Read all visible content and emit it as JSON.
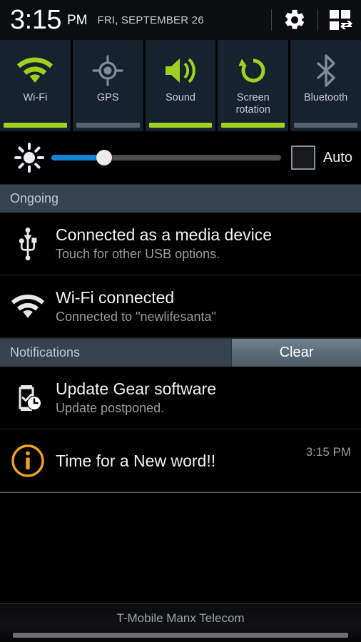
{
  "statusbar": {
    "time": "3:15",
    "ampm": "PM",
    "date": "FRI, SEPTEMBER 26",
    "settings_icon": "gear-icon",
    "panel_toggle_icon": "quick-settings-grid-icon"
  },
  "quick_toggles": [
    {
      "label": "Wi-Fi",
      "icon": "wifi-icon",
      "state": "on"
    },
    {
      "label": "GPS",
      "icon": "gps-crosshair-icon",
      "state": "off"
    },
    {
      "label": "Sound",
      "icon": "speaker-volume-icon",
      "state": "on"
    },
    {
      "label": "Screen\nrotation",
      "icon": "screen-rotation-icon",
      "state": "on"
    },
    {
      "label": "Bluetooth",
      "icon": "bluetooth-icon",
      "state": "off"
    }
  ],
  "brightness": {
    "icon": "brightness-sun-icon",
    "value_percent": 23,
    "auto_label": "Auto",
    "auto_checked": false
  },
  "sections": {
    "ongoing": {
      "title": "Ongoing"
    },
    "notifications": {
      "title": "Notifications",
      "clear_label": "Clear"
    }
  },
  "ongoing_items": [
    {
      "icon": "usb-icon",
      "title": "Connected as a media device",
      "subtitle": "Touch for other USB options.",
      "time": ""
    },
    {
      "icon": "wifi-icon",
      "title": "Wi-Fi connected",
      "subtitle": "Connected to \"newlifesanta\"",
      "time": ""
    }
  ],
  "notification_items": [
    {
      "icon": "gear-watch-update-icon",
      "title": "Update Gear software",
      "subtitle": "Update postponed.",
      "time": ""
    },
    {
      "icon": "info-circle-icon",
      "title": "Time for a New word!!",
      "subtitle": "",
      "time": "3:15 PM"
    }
  ],
  "footer": {
    "carrier": "T-Mobile Manx Telecom"
  },
  "colors": {
    "toggle_on": "#9fd220",
    "toggle_off": "#56636f",
    "tile_bg": "#16222d",
    "section_header_bg": "#36434e",
    "slider_fill": "#1184d2",
    "info_icon": "#f0a21e"
  }
}
